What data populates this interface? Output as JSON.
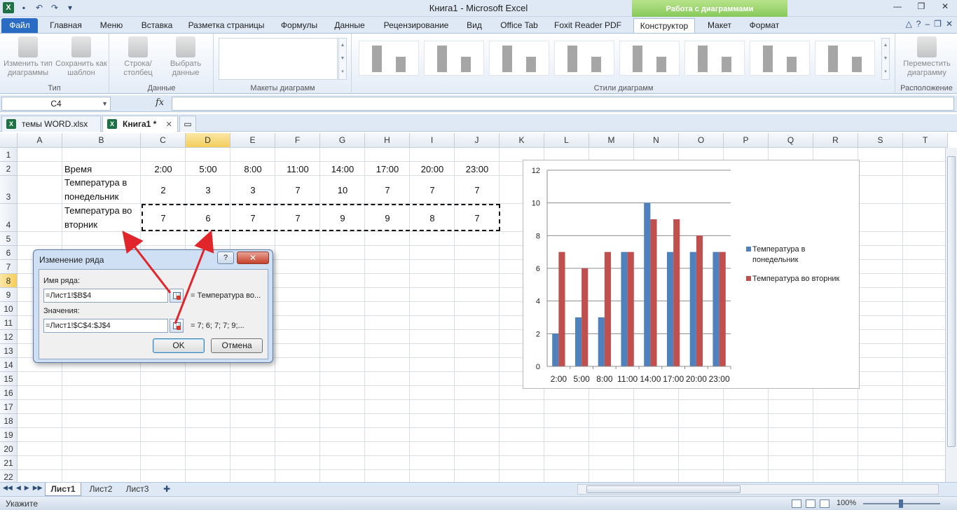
{
  "window": {
    "title": "Книга1  -  Microsoft Excel",
    "context_title": "Работа с диаграммами",
    "app_icon": "excel-icon"
  },
  "tabs": [
    {
      "label": "Файл"
    },
    {
      "label": "Главная"
    },
    {
      "label": "Меню"
    },
    {
      "label": "Вставка"
    },
    {
      "label": "Разметка страницы"
    },
    {
      "label": "Формулы"
    },
    {
      "label": "Данные"
    },
    {
      "label": "Рецензирование"
    },
    {
      "label": "Вид"
    },
    {
      "label": "Office Tab"
    },
    {
      "label": "Foxit Reader PDF"
    },
    {
      "label": "Конструктор"
    },
    {
      "label": "Макет"
    },
    {
      "label": "Формат"
    }
  ],
  "ribbon": {
    "change_type": "Изменить тип диаграммы",
    "save_template": "Сохранить как шаблон",
    "group_type": "Тип",
    "row_col": "Строка/столбец",
    "select_data": "Выбрать данные",
    "group_data": "Данные",
    "group_layouts": "Макеты диаграмм",
    "group_styles": "Стили диаграмм",
    "move_chart": "Переместить диаграмму",
    "group_location": "Расположение"
  },
  "formula_bar": {
    "name_box": "C4",
    "fx": "fx",
    "value": ""
  },
  "workbook_tabs": [
    {
      "label": "темы WORD.xlsx",
      "active": false
    },
    {
      "label": "Книга1 *",
      "active": true
    }
  ],
  "grid": {
    "columns": [
      "A",
      "B",
      "C",
      "D",
      "E",
      "F",
      "G",
      "H",
      "I",
      "J",
      "K",
      "L",
      "M",
      "N",
      "O",
      "P",
      "Q",
      "R",
      "S",
      "T"
    ],
    "rows": [
      "1",
      "2",
      "3",
      "4",
      "5",
      "6",
      "7",
      "8",
      "9",
      "10",
      "11",
      "12",
      "13",
      "14",
      "15",
      "16",
      "17",
      "18",
      "19",
      "20",
      "21",
      "22"
    ],
    "row2": {
      "label": "Время",
      "values": [
        "2:00",
        "5:00",
        "8:00",
        "11:00",
        "14:00",
        "17:00",
        "20:00",
        "23:00"
      ]
    },
    "row3": {
      "label": "Температура в понедельник",
      "values": [
        "2",
        "3",
        "3",
        "7",
        "10",
        "7",
        "7",
        "7"
      ]
    },
    "row4": {
      "label": "Температура во вторник",
      "values": [
        "7",
        "6",
        "7",
        "7",
        "9",
        "9",
        "8",
        "7"
      ]
    }
  },
  "dialog": {
    "title": "Изменение ряда",
    "help": "?",
    "close": "✕",
    "name_label": "Имя ряда:",
    "name_value": "=Лист1!$B$4",
    "name_preview": "= Температура во...",
    "values_label": "Значения:",
    "values_value": "=Лист1!$C$4:$J$4",
    "values_preview": "= 7; 6; 7; 7; 9;...",
    "ok": "OK",
    "cancel": "Отмена"
  },
  "chart_data": {
    "type": "bar",
    "categories": [
      "2:00",
      "5:00",
      "8:00",
      "11:00",
      "14:00",
      "17:00",
      "20:00",
      "23:00"
    ],
    "series": [
      {
        "name": "Температура в понедельник",
        "values": [
          2,
          3,
          3,
          7,
          10,
          7,
          7,
          7
        ],
        "color": "#4f81bd"
      },
      {
        "name": "Температура во вторник",
        "values": [
          7,
          6,
          7,
          7,
          9,
          9,
          8,
          7
        ],
        "color": "#c0504d"
      }
    ],
    "title": "",
    "xlabel": "",
    "ylabel": "",
    "ylim": [
      0,
      12
    ],
    "yticks": [
      0,
      2,
      4,
      6,
      8,
      10,
      12
    ],
    "grid": true,
    "legend": "right"
  },
  "sheets": [
    {
      "label": "Лист1",
      "active": true
    },
    {
      "label": "Лист2",
      "active": false
    },
    {
      "label": "Лист3",
      "active": false
    }
  ],
  "status": {
    "mode": "Укажите",
    "zoom": "100%"
  },
  "annotation": {
    "arrow_color": "#e0262b"
  }
}
